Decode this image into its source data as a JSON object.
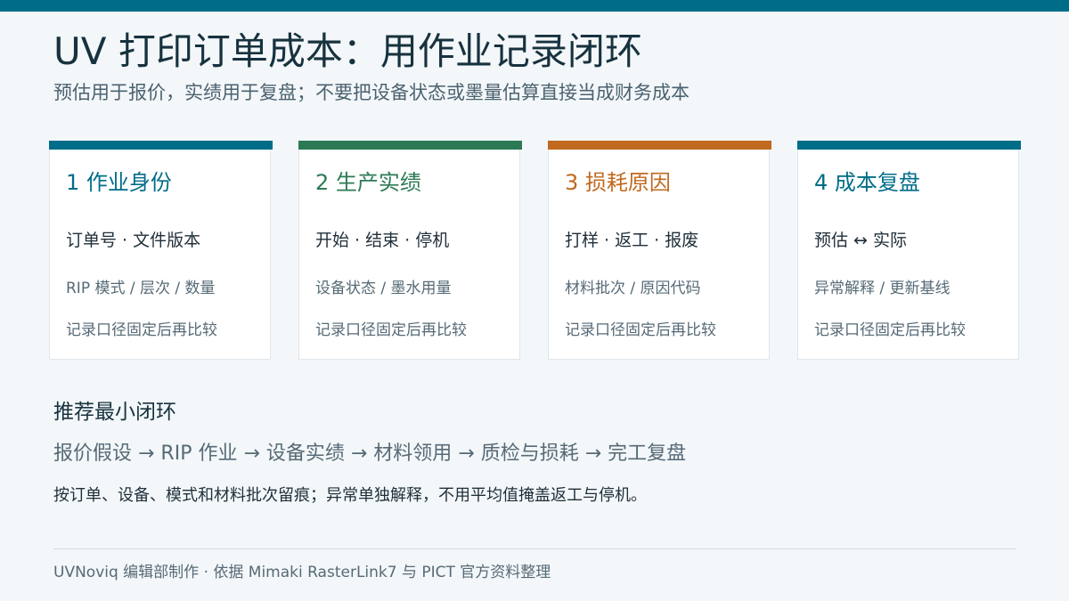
{
  "header": {
    "title": "UV 打印订单成本：用作业记录闭环",
    "subtitle": "预估用于报价，实绩用于复盘；不要把设备状态或墨量估算直接当成财务成本"
  },
  "cards": [
    {
      "title": "1  作业身份",
      "line1": "订单号 · 文件版本",
      "line2": "RIP 模式 / 层次 / 数量",
      "line3": "记录口径固定后再比较",
      "accent": "#006d88"
    },
    {
      "title": "2  生产实绩",
      "line1": "开始 · 结束 · 停机",
      "line2": "设备状态 / 墨水用量",
      "line3": "记录口径固定后再比较",
      "accent": "#2c7a55"
    },
    {
      "title": "3  损耗原因",
      "line1": "打样 · 返工 · 报废",
      "line2": "材料批次 / 原因代码",
      "line3": "记录口径固定后再比较",
      "accent": "#c0691f"
    },
    {
      "title": "4  成本复盘",
      "line1": "预估 ↔ 实际",
      "line2": "异常解释 / 更新基线",
      "line3": "记录口径固定后再比较",
      "accent": "#006d88"
    }
  ],
  "loop": {
    "heading": "推荐最小闭环",
    "flow": "报价假设 → RIP 作业 → 设备实绩 → 材料领用 → 质检与损耗 → 完工复盘",
    "note": "按订单、设备、模式和材料批次留痕；异常单独解释，不用平均值掩盖返工与停机。"
  },
  "footer": {
    "text": "UVNoviq 编辑部制作 · 依据 Mimaki RasterLink7 与 PICT 官方资料整理"
  },
  "colors": {
    "brand": "#006d88",
    "green": "#2c7a55",
    "orange": "#c0691f",
    "background": "#f3f7f9"
  }
}
